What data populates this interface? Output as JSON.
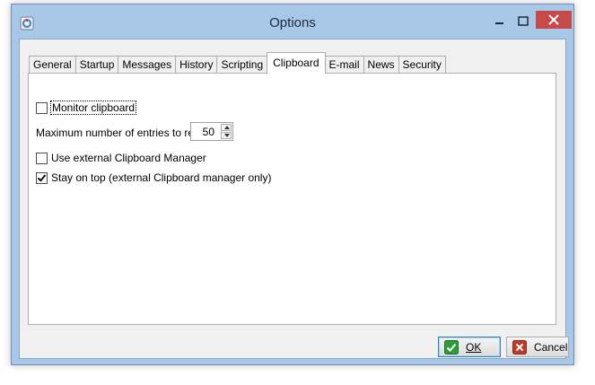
{
  "window": {
    "title": "Options",
    "app_icon": "app-icon",
    "controls": [
      "minimize-icon",
      "maximize-icon",
      "close-icon"
    ]
  },
  "tabs": [
    {
      "label": "General"
    },
    {
      "label": "Startup"
    },
    {
      "label": "Messages"
    },
    {
      "label": "History"
    },
    {
      "label": "Scripting"
    },
    {
      "label": "Clipboard",
      "active": true
    },
    {
      "label": "E-mail"
    },
    {
      "label": "News"
    },
    {
      "label": "Security"
    }
  ],
  "clipboard": {
    "monitor_label": "Monitor clipboard",
    "monitor_checked": false,
    "max_entries_label": "Maximum number of entries to retain:",
    "max_entries_value": "50",
    "external_manager_label": "Use external Clipboard Manager",
    "external_manager_checked": false,
    "stay_on_top_label": "Stay on top (external Clipboard manager only)",
    "stay_on_top_checked": true
  },
  "buttons": {
    "ok_label": "OK",
    "cancel_label": "Cancel",
    "ok_icon": "checkmark-icon",
    "cancel_icon": "x-icon"
  },
  "colors": {
    "titlebar": "#a9c8e8",
    "close_button": "#c74a4a",
    "ok_icon": "#2f9a3a",
    "cancel_icon": "#c0392b"
  }
}
